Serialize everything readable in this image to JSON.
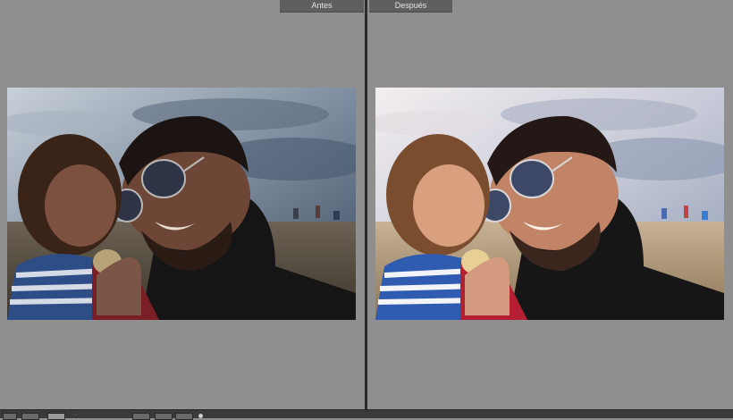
{
  "compare": {
    "before_label": "Antes",
    "after_label": "Después"
  },
  "photo": {
    "before_tone": "dark-muted",
    "after_tone": "bright-warm"
  },
  "colors": {
    "panel_bg": "#8f8f8f",
    "label_bg": "#5f5f5f",
    "divider": "#2b2b2b",
    "toolbar_bg": "#3a3a3a"
  }
}
